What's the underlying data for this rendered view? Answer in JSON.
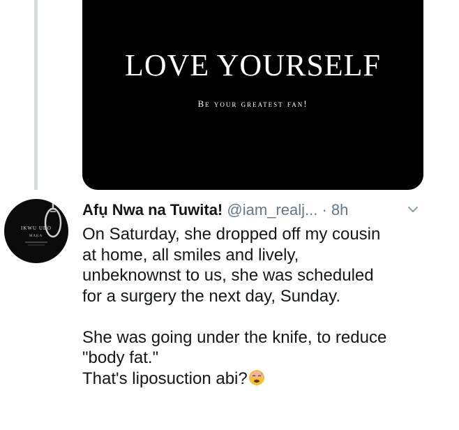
{
  "media": {
    "title": "LOVE YOURSELF",
    "subtitle": "Be your greatest fan!"
  },
  "avatar": {
    "line1": "IKWU UDO",
    "line2": "MAKA"
  },
  "tweet": {
    "display_name": "Afụ Nwa na Tuwita!",
    "handle": "@iam_realj...",
    "time": "· 8h",
    "body_lines": [
      "On Saturday, she dropped off my cousin",
      "at home, all smiles and lively,",
      "unbeknownst to us, she was scheduled",
      "for a surgery the next day, Sunday.",
      "She was going under the knife, to reduce",
      "\"body fat.\"",
      "That's liposuction abi?"
    ],
    "emoji_icon": "anxious-face-with-sweat-icon"
  },
  "colors": {
    "thread_line": "#d5dee4",
    "secondary_text": "#657786",
    "primary_text": "#14171a"
  }
}
